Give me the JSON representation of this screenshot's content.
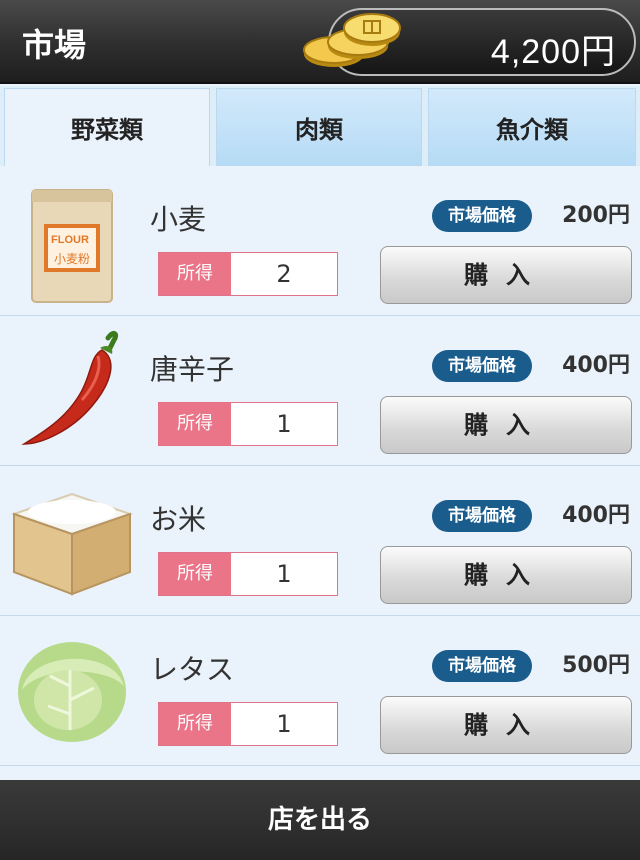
{
  "header": {
    "title": "市場",
    "money": "4,200円"
  },
  "tabs": [
    {
      "label": "野菜類",
      "active": true
    },
    {
      "label": "肉類",
      "active": false
    },
    {
      "label": "魚介類",
      "active": false
    }
  ],
  "items": [
    {
      "name": "小麦",
      "price_label": "市場価格",
      "price": "200円",
      "owned_label": "所得",
      "owned": "2",
      "buy_label": "購入",
      "icon": "wheat-flour-bag-icon",
      "bag_text_en": "FLOUR",
      "bag_text_jp": "小麦粉"
    },
    {
      "name": "唐辛子",
      "price_label": "市場価格",
      "price": "400円",
      "owned_label": "所得",
      "owned": "1",
      "buy_label": "購入",
      "icon": "chili-pepper-icon"
    },
    {
      "name": "お米",
      "price_label": "市場価格",
      "price": "400円",
      "owned_label": "所得",
      "owned": "1",
      "buy_label": "購入",
      "icon": "rice-box-icon"
    },
    {
      "name": "レタス",
      "price_label": "市場価格",
      "price": "500円",
      "owned_label": "所得",
      "owned": "1",
      "buy_label": "購入",
      "icon": "lettuce-icon"
    }
  ],
  "footer": {
    "leave_label": "店を出る"
  },
  "colors": {
    "badge": "#1a5c8c",
    "owned_label": "#ea7488",
    "header": "#2e2e2e",
    "background": "#eaf3fb"
  }
}
